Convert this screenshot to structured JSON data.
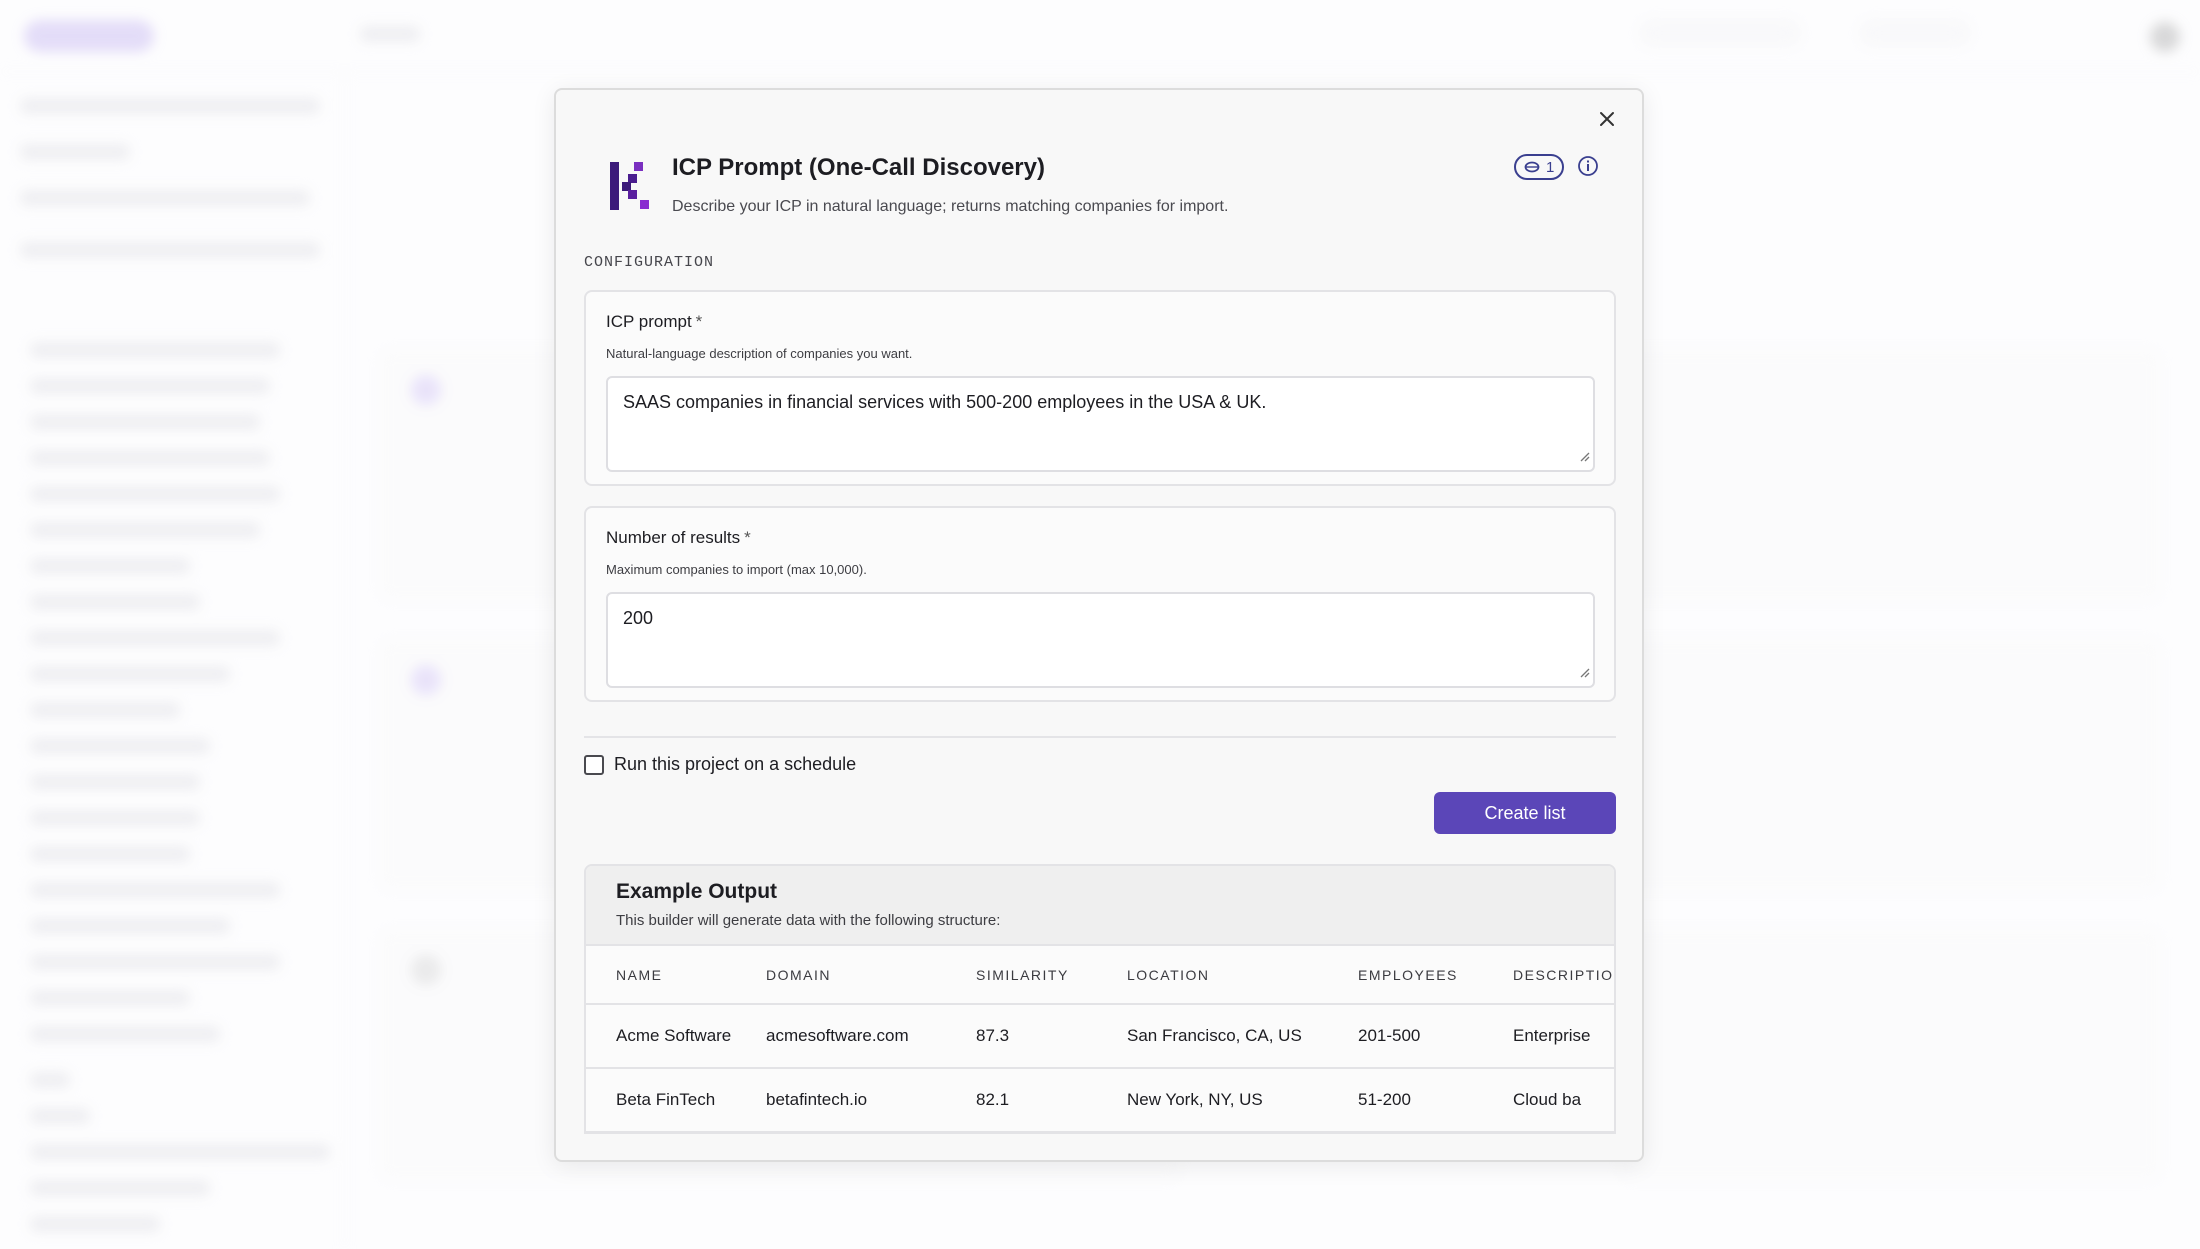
{
  "modal": {
    "close_icon": "close-icon",
    "logo_icon": "brand-k-logo-icon",
    "title": "ICP Prompt (One-Call Discovery)",
    "subtitle": "Describe your ICP in natural language; returns matching companies for import.",
    "credit_badge": {
      "icon": "coin-icon",
      "count": "1"
    },
    "info_icon": "info-icon",
    "section_label": "CONFIGURATION",
    "fields": {
      "icp_prompt": {
        "label": "ICP prompt",
        "required_marker": "*",
        "help": "Natural-language description of companies you want.",
        "value": "SAAS companies in financial services with 500-200 employees in the USA & UK."
      },
      "num_results": {
        "label": "Number of results",
        "required_marker": "*",
        "help": "Maximum companies to import (max 10,000).",
        "value": "200"
      }
    },
    "schedule_label": "Run this project on a schedule",
    "schedule_checked": false,
    "create_button": "Create list",
    "accent_color": "#5b46b8",
    "example": {
      "title": "Example Output",
      "subtitle": "This builder will generate data with the following structure:",
      "columns": [
        "NAME",
        "DOMAIN",
        "SIMILARITY",
        "LOCATION",
        "EMPLOYEES",
        "DESCRIPTION"
      ],
      "rows": [
        [
          "Acme Software",
          "acmesoftware.com",
          "87.3",
          "San Francisco, CA, US",
          "201-500",
          "Enterprise"
        ],
        [
          "Beta FinTech",
          "betafintech.io",
          "82.1",
          "New York, NY, US",
          "51-200",
          "Cloud ba"
        ]
      ]
    }
  }
}
